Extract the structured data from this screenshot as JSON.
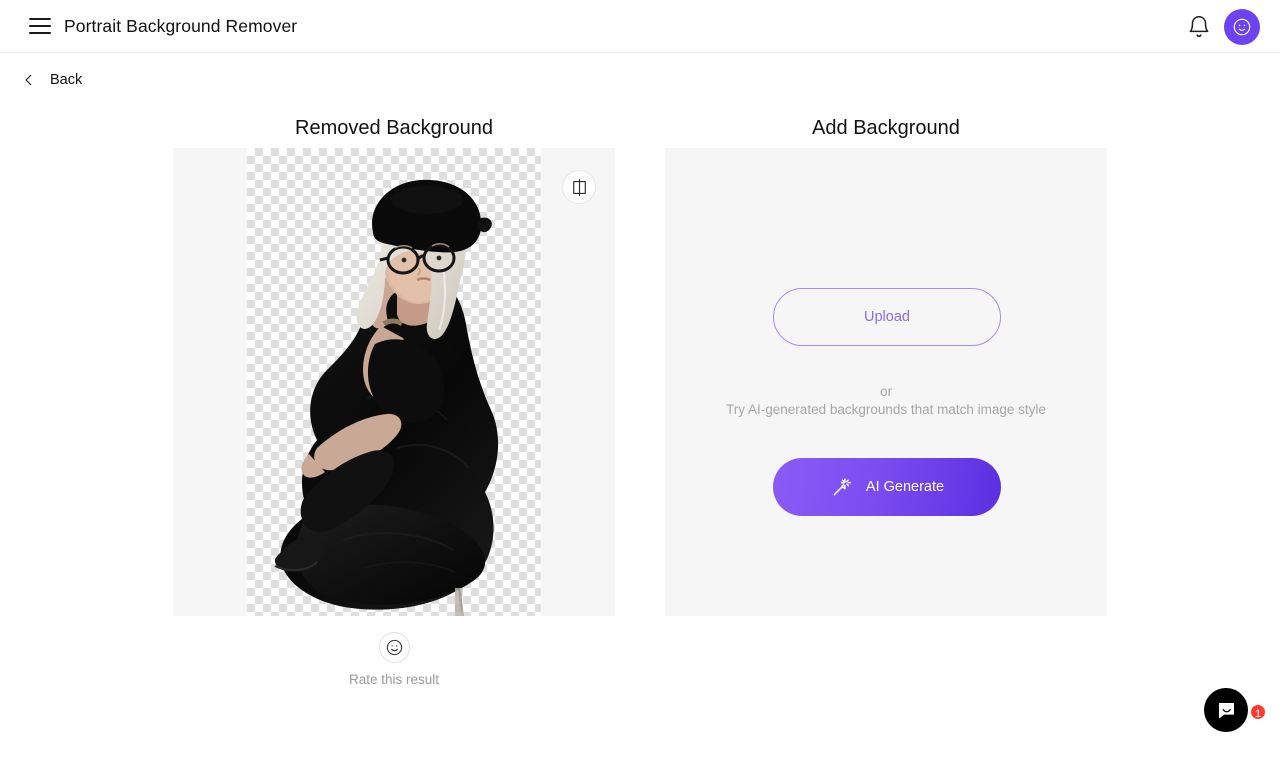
{
  "header": {
    "menu_icon": "hamburger-menu-icon",
    "title": "Portrait Background Remover",
    "notification_icon": "bell-icon",
    "avatar_icon": "smiley-avatar-icon",
    "avatar_color": "#6d42f0"
  },
  "nav": {
    "back_icon": "chevron-left-icon",
    "back_label": "Back"
  },
  "left_panel": {
    "title": "Removed Background",
    "compare_icon": "split-compare-icon",
    "background": "checkerboard-transparency",
    "image_alt": "Portrait of a seated woman with white hair, black beret, glasses and black dress"
  },
  "rate": {
    "icon": "smiley-face-icon",
    "label": "Rate this result"
  },
  "right_panel": {
    "title": "Add Background",
    "upload_label": "Upload",
    "or_label": "or",
    "hint": "Try AI-generated backgrounds that match image style",
    "ai_icon": "magic-wand-icon",
    "ai_label": "AI Generate",
    "accent_color": "#7c4ef2",
    "outline_color": "#a98bf0"
  },
  "chat": {
    "icon": "chat-bubble-icon",
    "badge": "1",
    "badge_color": "#ff3b30"
  }
}
